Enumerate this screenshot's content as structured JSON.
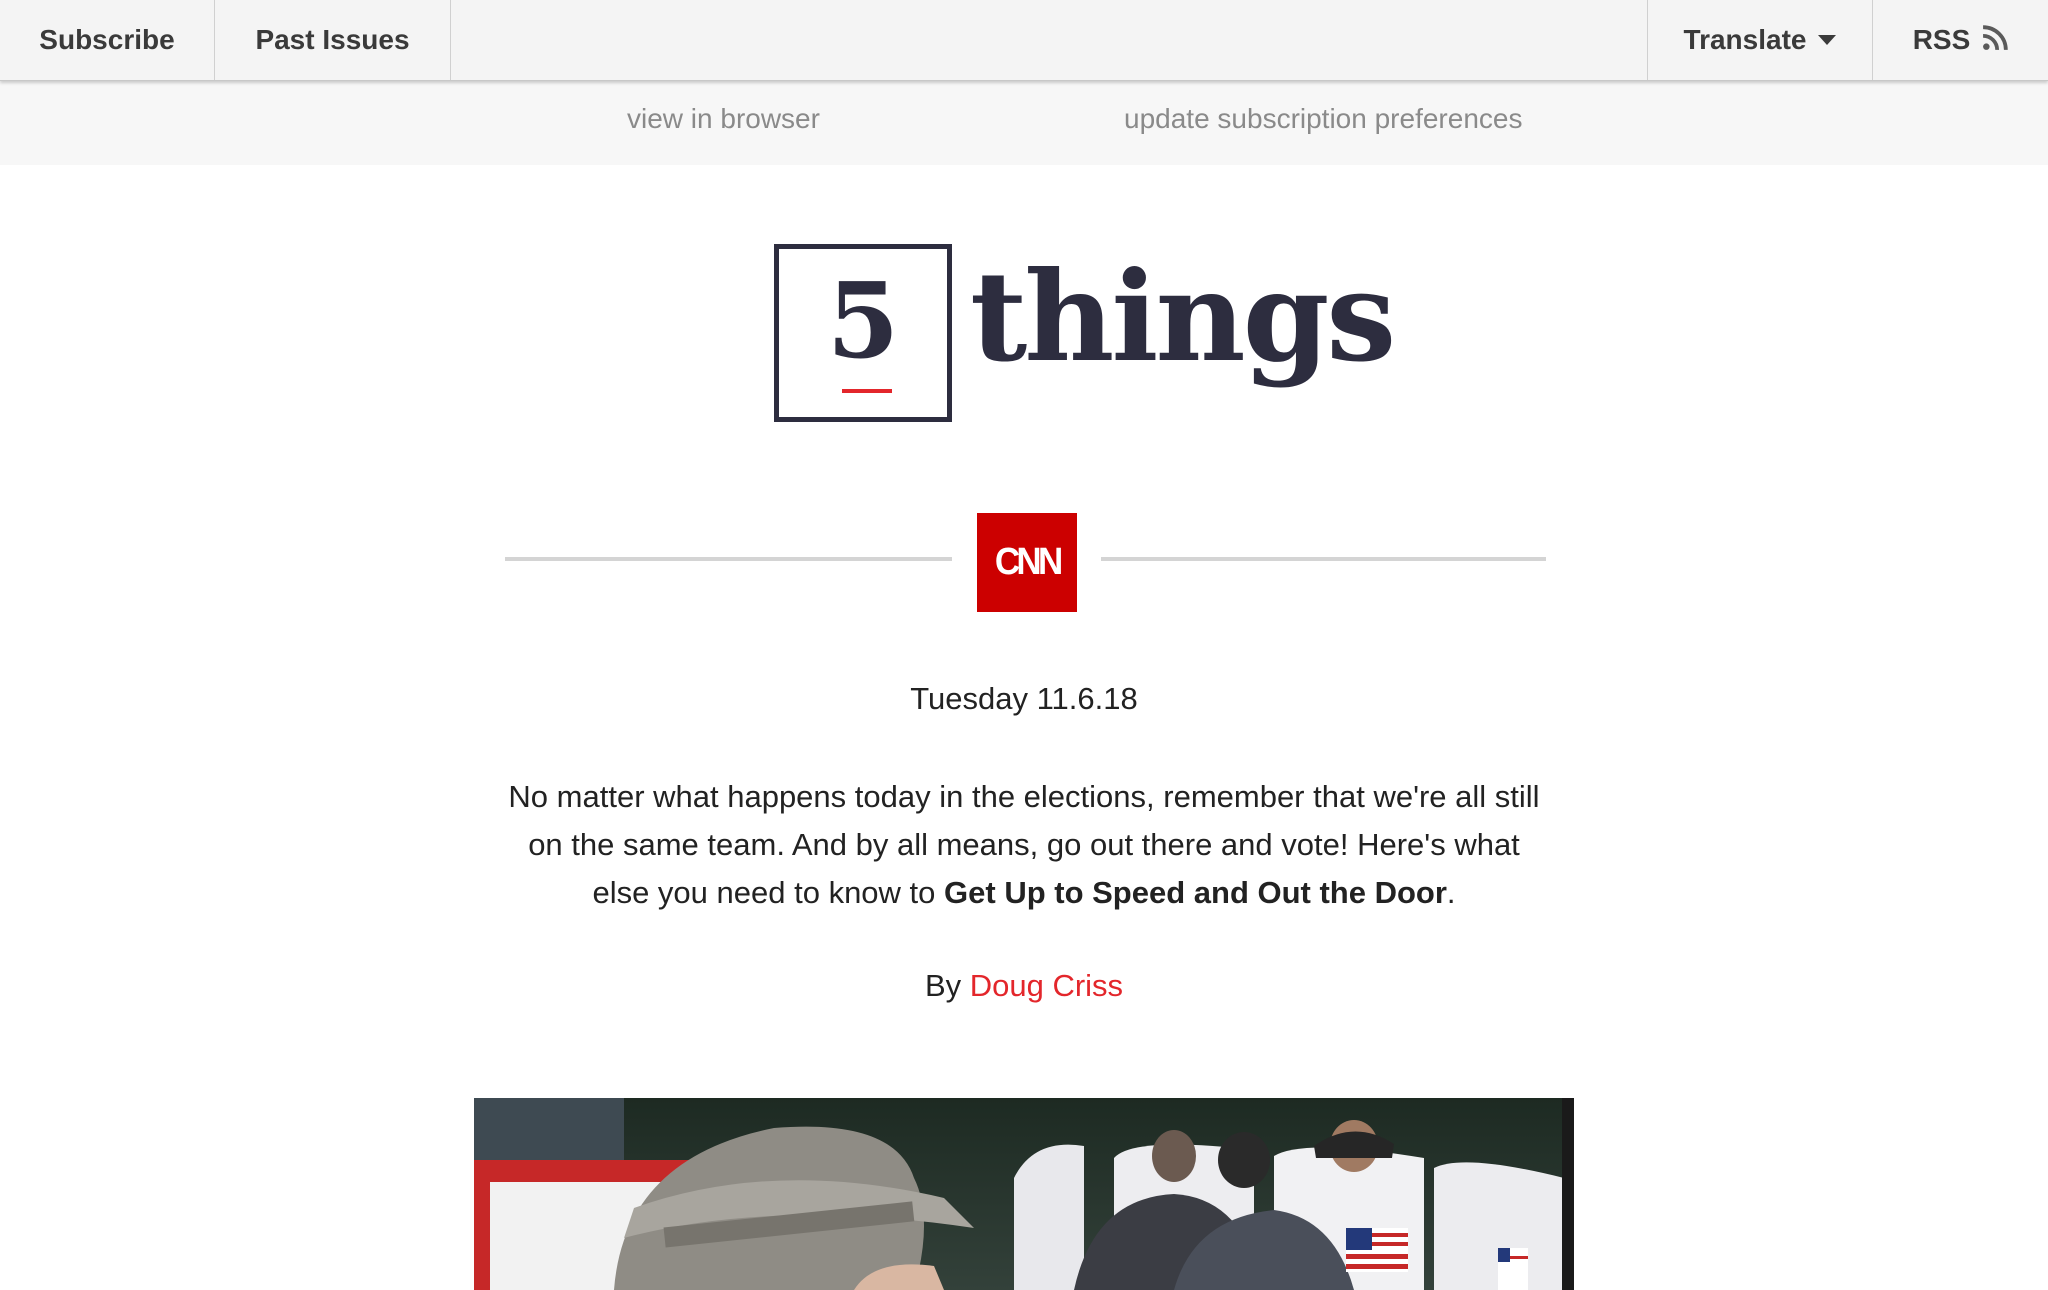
{
  "topbar": {
    "subscribe": "Subscribe",
    "past_issues": "Past Issues",
    "translate": "Translate",
    "rss": "RSS"
  },
  "preheader": {
    "view_in_browser": "view in browser",
    "update_preferences": "update subscription preferences"
  },
  "logo": {
    "number": "5",
    "word": "things"
  },
  "cnn_logo_text": "CNN",
  "newsletter": {
    "date": "Tuesday 11.6.18",
    "intro_text": "No matter what happens today in the elections, remember that we're all still on the same team. And by all means, go out there and vote! Here's what else you need to know to ",
    "intro_bold": "Get Up to Speed and Out the Door",
    "intro_end": ".",
    "by_label": "By ",
    "author": "Doug Criss"
  },
  "colors": {
    "accent_red": "#e3262b",
    "cnn_red": "#cc0000",
    "logo_navy": "#2d2d3f",
    "topbar_bg": "#f4f4f4",
    "link_gray": "#8a8a8a"
  },
  "icons": {
    "translate_caret": "chevron-down-icon",
    "rss": "rss-icon"
  }
}
